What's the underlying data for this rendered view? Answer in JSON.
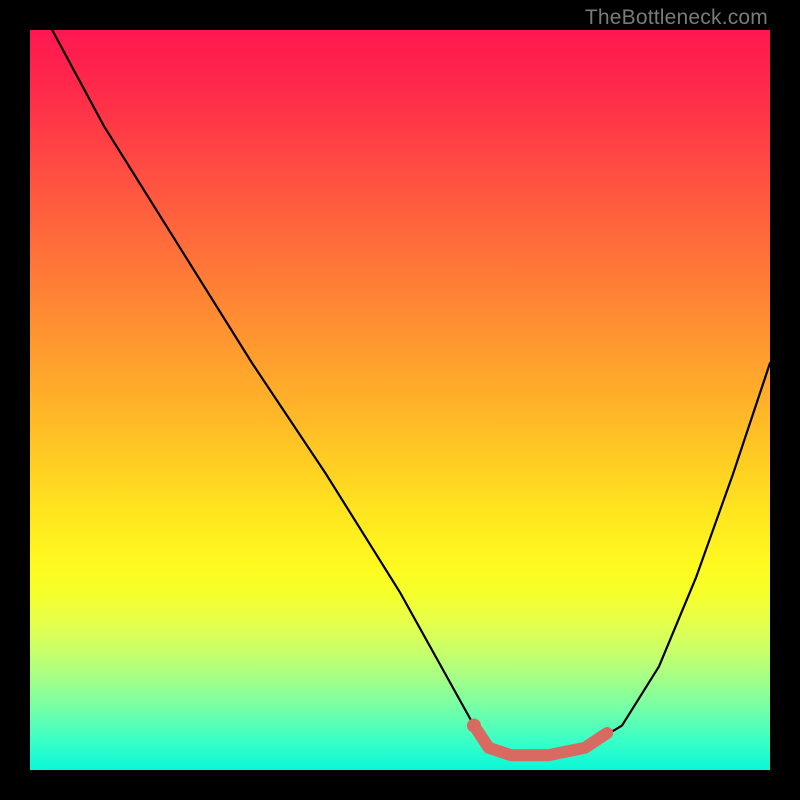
{
  "watermark": "TheBottleneck.com",
  "colors": {
    "highlight": "#d86a62",
    "curve": "#000000"
  },
  "chart_data": {
    "type": "line",
    "title": "",
    "xlabel": "",
    "ylabel": "",
    "xlim": [
      0,
      100
    ],
    "ylim": [
      0,
      100
    ],
    "grid": false,
    "legend": false,
    "series": [
      {
        "name": "bottleneck-curve",
        "x": [
          3,
          10,
          20,
          30,
          40,
          50,
          55,
          60,
          62,
          65,
          70,
          75,
          80,
          85,
          90,
          95,
          100
        ],
        "values": [
          100,
          87,
          71,
          55,
          40,
          24,
          15,
          6,
          3,
          2,
          2,
          3,
          6,
          14,
          26,
          40,
          55
        ]
      }
    ],
    "highlight_region": {
      "x": [
        60,
        62,
        65,
        70,
        75,
        78
      ],
      "values": [
        6,
        3,
        2,
        2,
        3,
        5
      ]
    },
    "highlight_dot": {
      "x": 60,
      "y": 6
    }
  }
}
